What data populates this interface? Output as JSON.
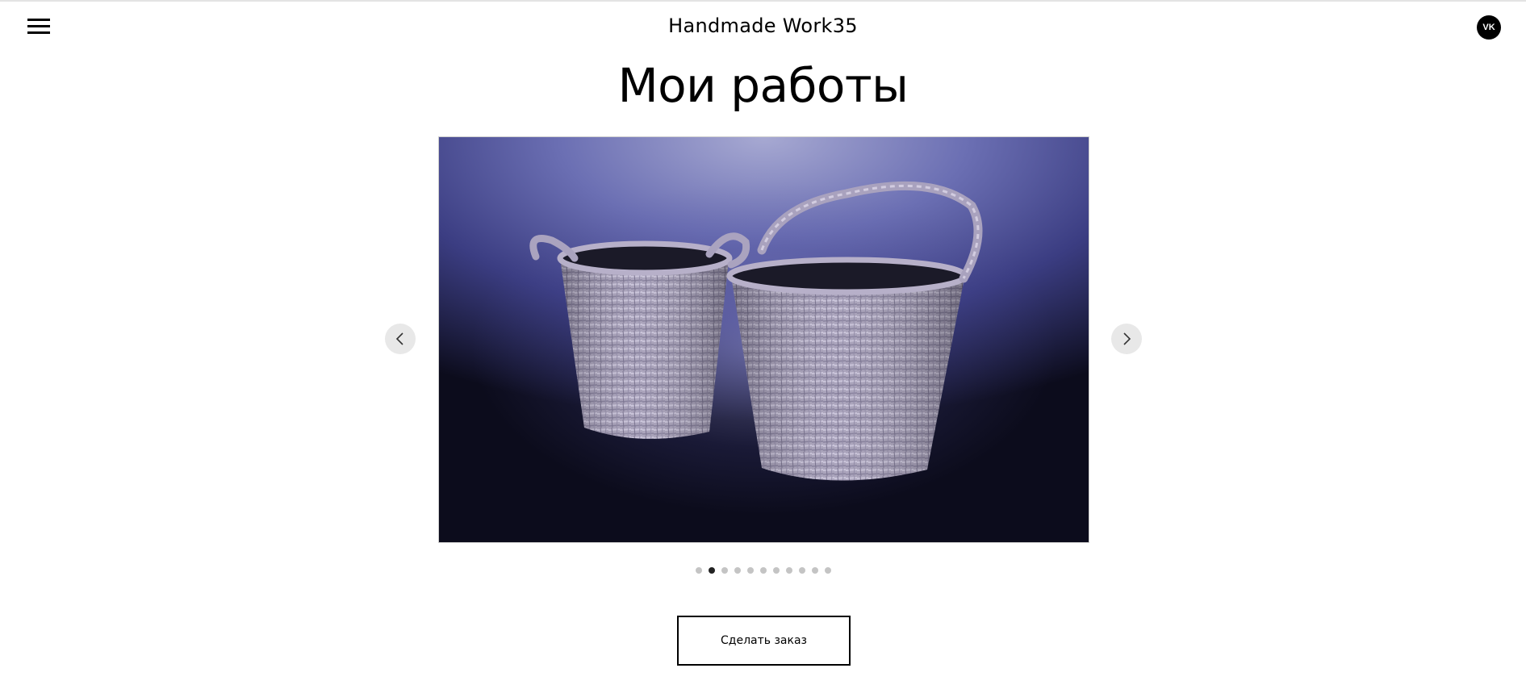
{
  "header": {
    "menu_icon": "hamburger-icon",
    "site_title": "Handmade Work35",
    "social_icon": "vk-icon",
    "social_label": "VK"
  },
  "main": {
    "title": "Мои работы",
    "slider": {
      "image": "wicker-baskets",
      "prev_icon": "chevron-left-icon",
      "next_icon": "chevron-right-icon",
      "slide_count": 11,
      "active_index": 1,
      "colors": {
        "backdrop_top": "#a7a9d2",
        "backdrop_mid": "#3b3d82",
        "backdrop_bottom": "#0c0c1c",
        "basket": "#a49db7"
      }
    },
    "order_button": "Сделать заказ"
  }
}
